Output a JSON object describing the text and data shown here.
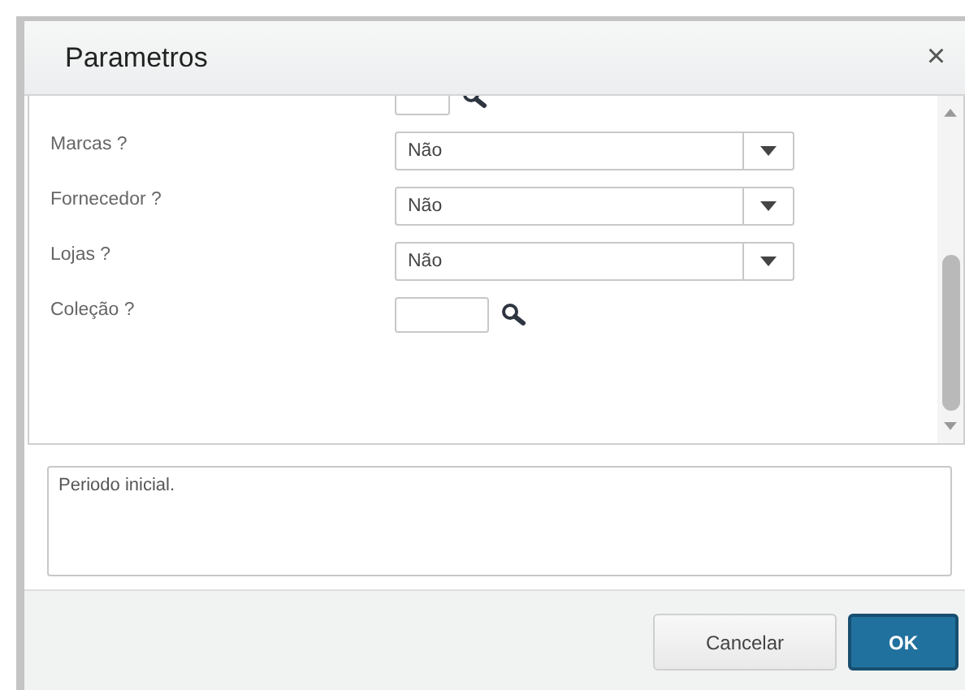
{
  "dialog": {
    "title": "Parametros",
    "close": "×"
  },
  "params": [
    {
      "kind": "lookup"
    },
    {
      "kind": "select",
      "label": "Marcas ?",
      "value": "Não"
    },
    {
      "kind": "select",
      "label": "Fornecedor ?",
      "value": "Não"
    },
    {
      "kind": "select",
      "label": "Lojas ?",
      "value": "Não"
    },
    {
      "kind": "lookup",
      "label": "Coleção ?"
    }
  ],
  "description": "Periodo inicial.",
  "buttons": [
    {
      "label": "Cancelar",
      "kind": "secondary"
    },
    {
      "label": "OK",
      "kind": "primary"
    }
  ]
}
